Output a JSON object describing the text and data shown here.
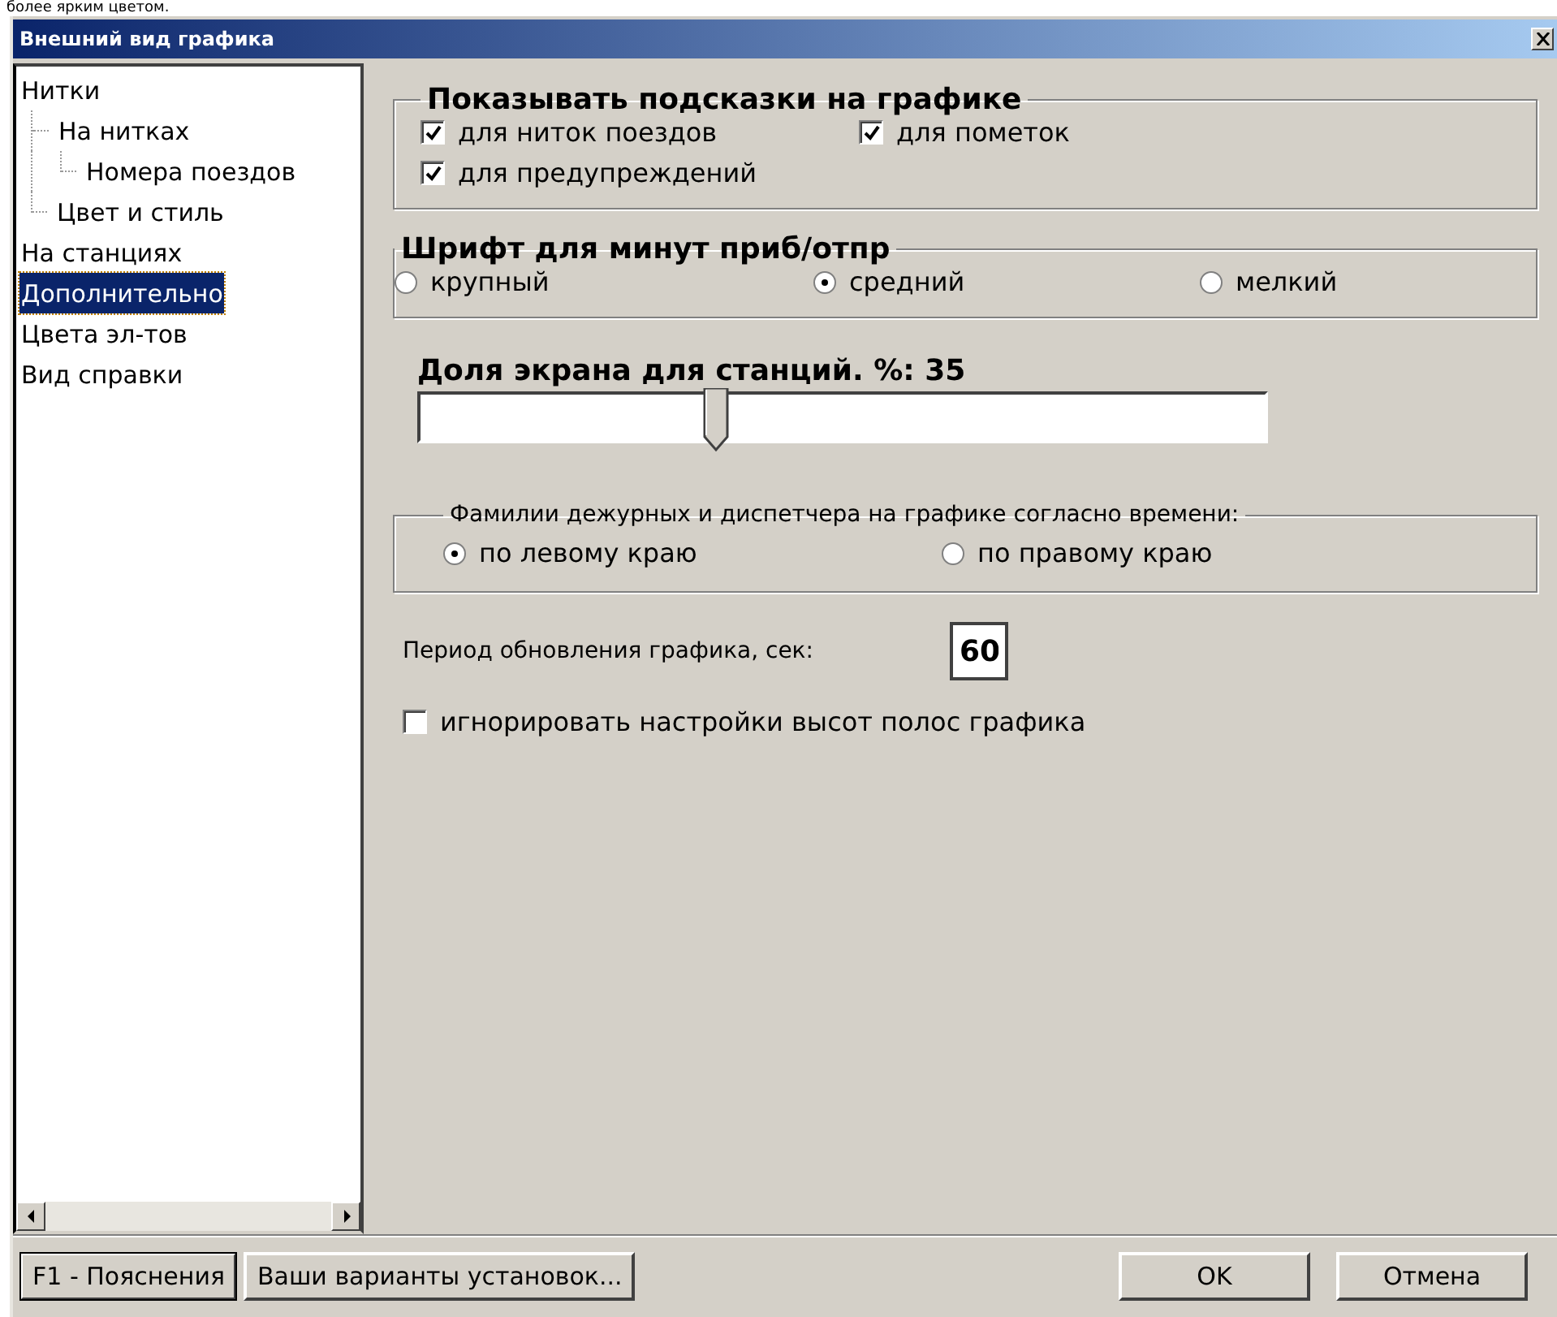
{
  "top_text": "более ярким цветом.",
  "window": {
    "title": "Внешний вид графика"
  },
  "tree": [
    {
      "label": "Нитки",
      "selected": false,
      "children": [
        {
          "label": "На нитках",
          "selected": false,
          "children": [
            {
              "label": "Номера поездов",
              "selected": false
            }
          ]
        },
        {
          "label": "Цвет и стиль",
          "selected": false
        }
      ]
    },
    {
      "label": "На станциях",
      "selected": false
    },
    {
      "label": "Дополнительно",
      "selected": true
    },
    {
      "label": "Цвета эл-тов",
      "selected": false
    },
    {
      "label": "Вид справки",
      "selected": false
    }
  ],
  "hints": {
    "title": "Показывать подсказки на графике",
    "options": [
      {
        "label": "для ниток поездов",
        "checked": true
      },
      {
        "label": "для пометок",
        "checked": true
      },
      {
        "label": "для предупреждений",
        "checked": true
      }
    ]
  },
  "font_size": {
    "title": "Шрифт для минут приб/отпр",
    "options": [
      {
        "label": "крупный",
        "selected": false
      },
      {
        "label": "средний",
        "selected": true
      },
      {
        "label": "мелкий",
        "selected": false
      }
    ]
  },
  "station_share": {
    "label": "Доля экрана для станций. %: 35",
    "level": 0.35
  },
  "names": {
    "title": "Фамилии дежурных и диспетчера на графике согласно времени:",
    "options": [
      {
        "label": "по левому краю",
        "selected": true
      },
      {
        "label": "по правому краю",
        "selected": false
      }
    ]
  },
  "period": {
    "label": "Период обновления графика, сек:",
    "value": "60"
  },
  "ignore_heights": {
    "label": "игнорировать настройки высот полос графика",
    "checked": false
  },
  "buttons_left": [
    {
      "label": "F1 - Пояснения",
      "default": true
    },
    {
      "label": "Ваши варианты установок...",
      "default": false
    }
  ],
  "buttons_right": [
    {
      "label": "OK",
      "default": false
    },
    {
      "label": "Отмена",
      "default": false
    }
  ]
}
